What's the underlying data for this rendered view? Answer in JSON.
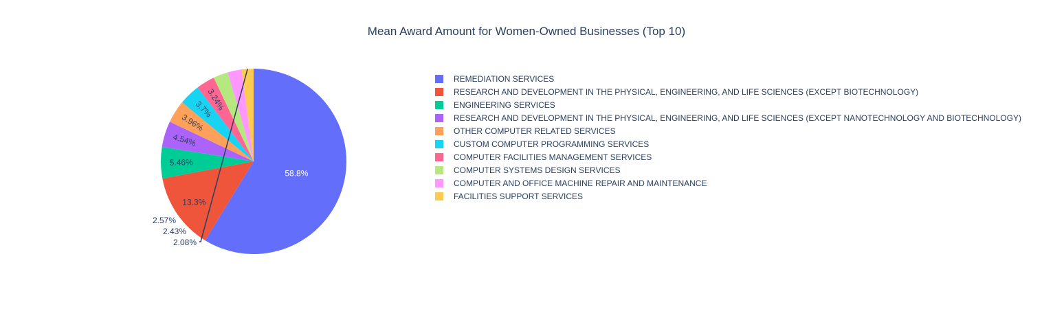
{
  "chart_data": {
    "type": "pie",
    "title": "Mean Award Amount for Women-Owned Businesses (Top 10)",
    "slices": [
      {
        "label": "REMEDIATION SERVICES",
        "percent": 58.8,
        "percent_label": "58.8%",
        "color": "#636efa"
      },
      {
        "label": "RESEARCH AND DEVELOPMENT IN THE PHYSICAL, ENGINEERING, AND LIFE SCIENCES (EXCEPT BIOTECHNOLOGY)",
        "percent": 13.3,
        "percent_label": "13.3%",
        "color": "#EF553B"
      },
      {
        "label": "ENGINEERING SERVICES",
        "percent": 5.46,
        "percent_label": "5.46%",
        "color": "#00cc96"
      },
      {
        "label": "RESEARCH AND DEVELOPMENT IN THE PHYSICAL, ENGINEERING, AND LIFE SCIENCES (EXCEPT NANOTECHNOLOGY AND BIOTECHNOLOGY)",
        "percent": 4.54,
        "percent_label": "4.54%",
        "color": "#ab63fa"
      },
      {
        "label": "OTHER COMPUTER RELATED SERVICES",
        "percent": 3.96,
        "percent_label": "3.96%",
        "color": "#FFA15A"
      },
      {
        "label": "CUSTOM COMPUTER PROGRAMMING SERVICES",
        "percent": 3.7,
        "percent_label": "3.7%",
        "color": "#19d3f3"
      },
      {
        "label": "COMPUTER FACILITIES MANAGEMENT SERVICES",
        "percent": 3.24,
        "percent_label": "3.24%",
        "color": "#FF6692"
      },
      {
        "label": "COMPUTER SYSTEMS DESIGN SERVICES",
        "percent": 2.57,
        "percent_label": "2.57%",
        "color": "#B6E880"
      },
      {
        "label": "COMPUTER AND OFFICE MACHINE REPAIR AND MAINTENANCE",
        "percent": 2.43,
        "percent_label": "2.43%",
        "color": "#FF97FF"
      },
      {
        "label": "FACILITIES SUPPORT SERVICES",
        "percent": 2.08,
        "percent_label": "2.08%",
        "color": "#FECB52"
      }
    ],
    "direction": "clockwise",
    "start_angle": "12 o'clock",
    "legend_position": "right",
    "outside_labels": [
      "2.57%",
      "2.43%",
      "2.08%"
    ]
  }
}
